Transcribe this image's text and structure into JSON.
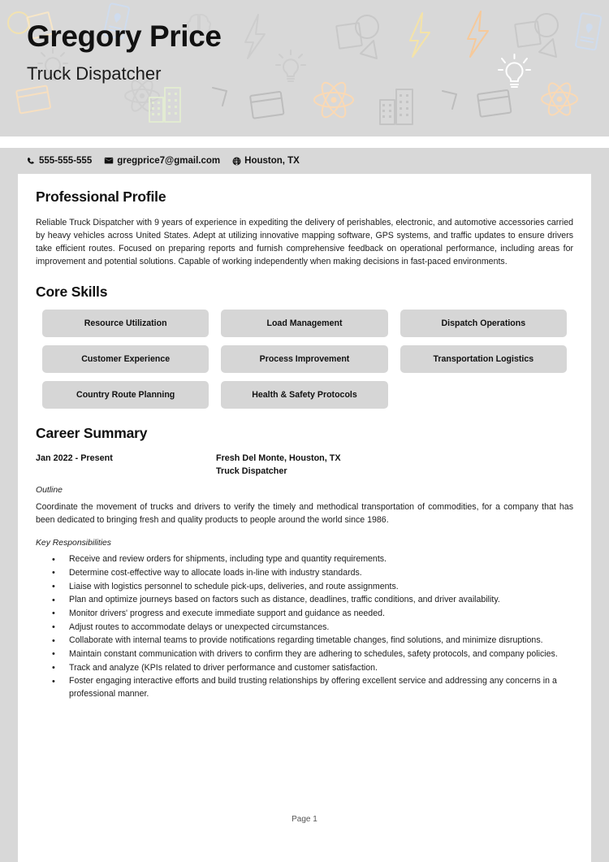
{
  "header": {
    "name": "Gregory Price",
    "job_title": "Truck Dispatcher",
    "background_color": "#d8d8d8",
    "decorative_icons": [
      "phone-location-icon",
      "lightning-bolt-icon",
      "lightbulb-icon",
      "atom-icon",
      "buildings-icon",
      "browser-window-icon",
      "square-icon",
      "circle-icon",
      "triangle-icon",
      "chevron-icon",
      "brain-icon",
      "mobile-icon"
    ]
  },
  "contact": {
    "phone": "555-555-555",
    "email": "gregprice7@gmail.com",
    "location": "Houston, TX",
    "phone_icon": "phone-icon",
    "email_icon": "envelope-icon",
    "location_icon": "globe-icon"
  },
  "profile": {
    "heading": "Professional Profile",
    "text": "Reliable Truck Dispatcher with 9 years of experience in expediting the delivery of perishables, electronic, and automotive accessories carried by heavy vehicles across United States. Adept at utilizing innovative mapping software, GPS systems, and traffic updates to ensure drivers take efficient routes. Focused on preparing reports and furnish comprehensive feedback on operational performance, including areas for improvement and potential solutions. Capable of working independently when making decisions in fast-paced environments."
  },
  "skills": {
    "heading": "Core Skills",
    "pill_color": "#d6d6d6",
    "items": [
      "Resource Utilization",
      "Load Management",
      "Dispatch Operations",
      "Customer Experience",
      "Process Improvement",
      "Transportation Logistics",
      "Country Route Planning",
      "Health & Safety Protocols"
    ]
  },
  "career": {
    "heading": "Career Summary",
    "dates": "Jan 2022 - Present",
    "company": "Fresh Del Monte, Houston, TX",
    "role": "Truck Dispatcher",
    "outline_label": "Outline",
    "outline_text": "Coordinate the movement of trucks and drivers to verify the timely and methodical transportation of commodities, for a company that has been dedicated to bringing fresh and quality products to people around the world since 1986.",
    "responsibilities_label": "Key Responsibilities",
    "responsibilities": [
      "Receive and review orders for shipments, including type and quantity requirements.",
      "Determine cost-effective way to allocate loads in-line with industry standards.",
      "Liaise with logistics personnel to schedule pick-ups, deliveries, and route assignments.",
      "Plan and optimize journeys based on factors such as distance, deadlines, traffic conditions, and driver availability.",
      "Monitor drivers' progress and execute immediate support and guidance as needed.",
      "Adjust routes to accommodate delays or unexpected circumstances.",
      "Collaborate with internal teams to provide notifications regarding timetable changes, find solutions, and minimize disruptions.",
      "Maintain constant communication with drivers to confirm they are adhering to schedules, safety protocols, and company policies.",
      "Track and analyze (KPIs related to driver performance and customer satisfaction.",
      "Foster engaging interactive efforts and build trusting relationships by offering excellent service and addressing any concerns in a professional manner."
    ]
  },
  "footer": {
    "page_label": "Page 1"
  }
}
